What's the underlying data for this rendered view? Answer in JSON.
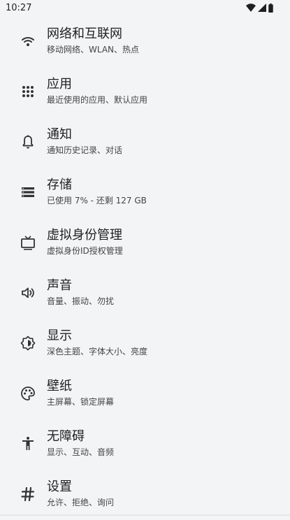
{
  "status_bar": {
    "time": "10:27",
    "icons": [
      "wifi-icon",
      "cell-signal-icon",
      "battery-icon"
    ]
  },
  "settings": [
    {
      "icon": "wifi-icon",
      "title": "网络和互联网",
      "subtitle": "移动网络、WLAN、热点"
    },
    {
      "icon": "apps-grid-icon",
      "title": "应用",
      "subtitle": "最近使用的应用、默认应用"
    },
    {
      "icon": "bell-icon",
      "title": "通知",
      "subtitle": "通知历史记录、对话"
    },
    {
      "icon": "storage-icon",
      "title": "存储",
      "subtitle": "已使用 7% - 还剩 127 GB"
    },
    {
      "icon": "tv-icon",
      "title": "虚拟身份管理",
      "subtitle": "虚拟身份ID授权管理"
    },
    {
      "icon": "volume-icon",
      "title": "声音",
      "subtitle": "音量、振动、勿扰"
    },
    {
      "icon": "brightness-icon",
      "title": "显示",
      "subtitle": "深色主题、字体大小、亮度"
    },
    {
      "icon": "palette-icon",
      "title": "壁纸",
      "subtitle": "主屏幕、锁定屏幕"
    },
    {
      "icon": "accessibility-icon",
      "title": "无障碍",
      "subtitle": "显示、互动、音频"
    },
    {
      "icon": "hash-icon",
      "title": "设置",
      "subtitle": "允许、拒绝、询问"
    }
  ]
}
